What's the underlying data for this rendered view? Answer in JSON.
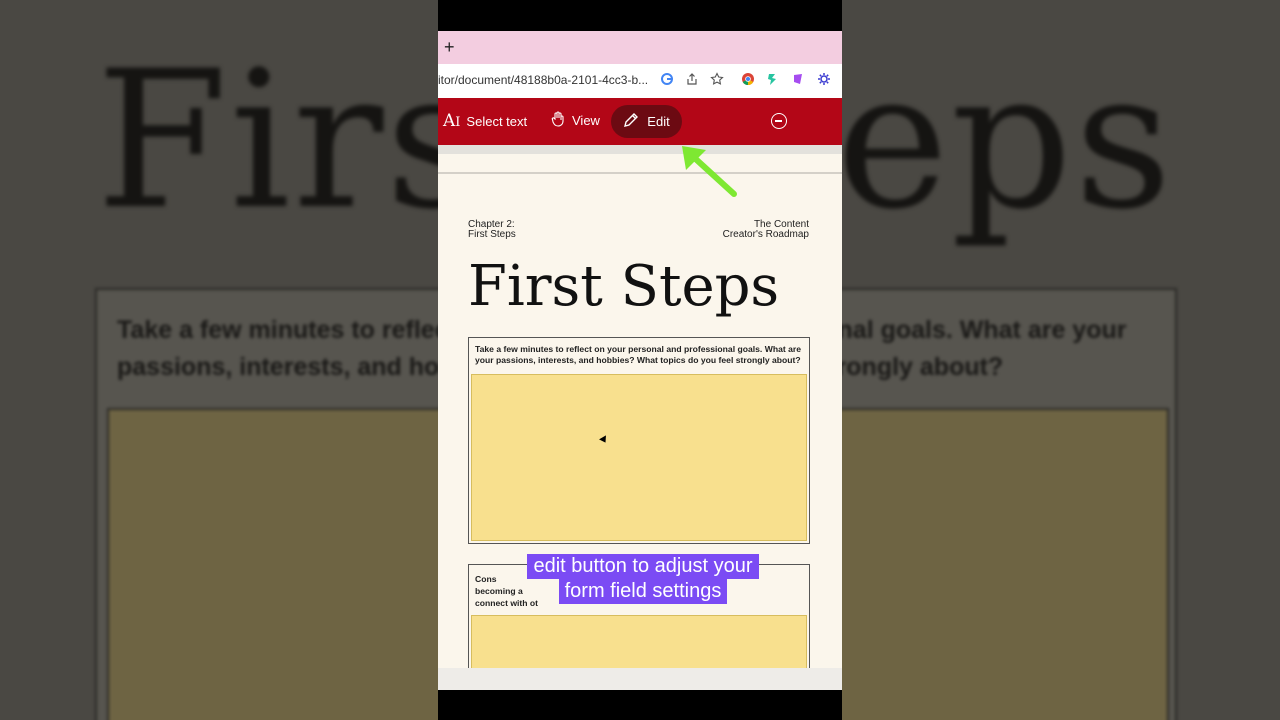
{
  "background": {
    "title": "First Steps",
    "question": "Take a few minutes to reflect on your personal and professional goals. What are your passions, interests, and hobbies? What topics do you feel strongly about?"
  },
  "browser": {
    "new_tab_symbol": "+",
    "url": "itor/document/48188b0a-2101-4cc3-b...",
    "icons": [
      "google-lens-icon",
      "share-icon",
      "bookmark-star-icon",
      "chrome-icon",
      "extension-icon",
      "extension-icon",
      "settings-icon"
    ]
  },
  "toolbar": {
    "select_text_label": "Select text",
    "view_label": "View",
    "edit_label": "Edit"
  },
  "document": {
    "chapter_line1": "Chapter 2:",
    "chapter_line2": "First Steps",
    "brand_line1": "The Content",
    "brand_line2": "Creator's Roadmap",
    "title": "First Steps",
    "question1": "Take a few minutes to reflect on your personal and professional goals. What are your passions, interests, and hobbies? What topics do you feel strongly about?",
    "question2_part1": "Cons",
    "question2_part2": "becoming a",
    "question2_part3": "connect with ot"
  },
  "caption": {
    "line1": "edit button to adjust your",
    "line2": "form field settings"
  },
  "colors": {
    "toolbar": "#b30617",
    "tab_bar": "#f3cde0",
    "form_field": "#f8e08e",
    "caption_bg": "#7b4bf4",
    "arrow": "#7ee832"
  }
}
